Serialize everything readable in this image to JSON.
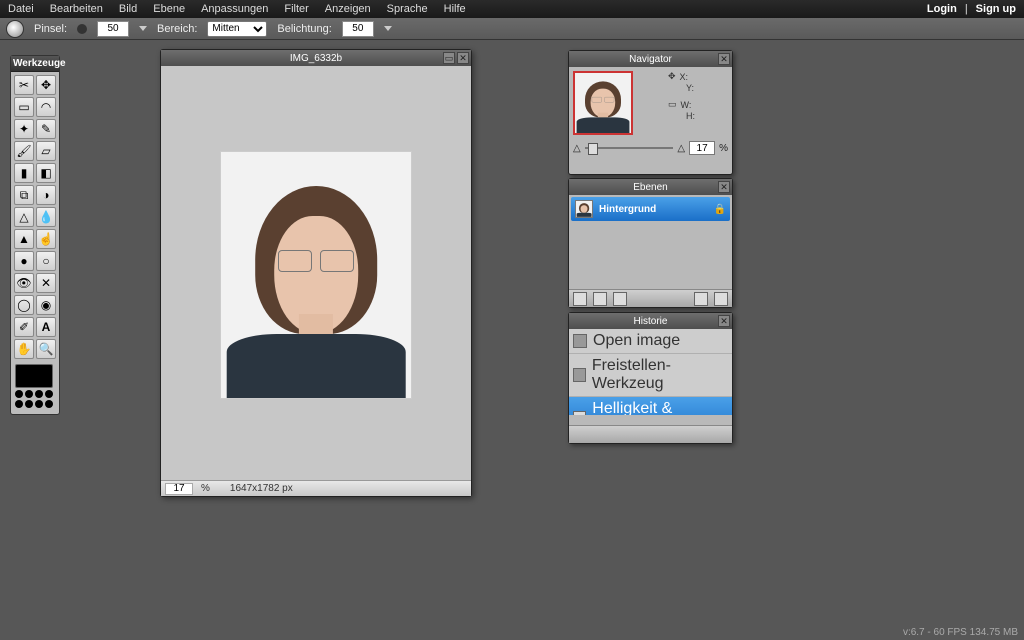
{
  "menu": {
    "items": [
      "Datei",
      "Bearbeiten",
      "Bild",
      "Ebene",
      "Anpassungen",
      "Filter",
      "Anzeigen",
      "Sprache",
      "Hilfe"
    ],
    "login": "Login",
    "signup": "Sign up",
    "sep": "|"
  },
  "options": {
    "pinsel_label": "Pinsel:",
    "pinsel_val": "50",
    "bereich_label": "Bereich:",
    "bereich_val": "Mitten",
    "belichtung_label": "Belichtung:",
    "belichtung_val": "50"
  },
  "tools_panel": {
    "title": "Werkzeuge"
  },
  "document": {
    "title": "IMG_6332b",
    "zoom": "17",
    "zoom_unit": "%",
    "dims": "1647x1782 px"
  },
  "navigator": {
    "title": "Navigator",
    "x": "X:",
    "y": "Y:",
    "w": "W:",
    "h": "H:",
    "zoom": "17",
    "unit": "%"
  },
  "layers": {
    "title": "Ebenen",
    "bg": "Hintergrund"
  },
  "history": {
    "title": "Historie",
    "items": [
      "Open image",
      "Freistellen-Werkzeug",
      "Helligkeit & Kontrast"
    ]
  },
  "footer": {
    "text": "v:6.7 - 60 FPS 134.75 MB"
  }
}
